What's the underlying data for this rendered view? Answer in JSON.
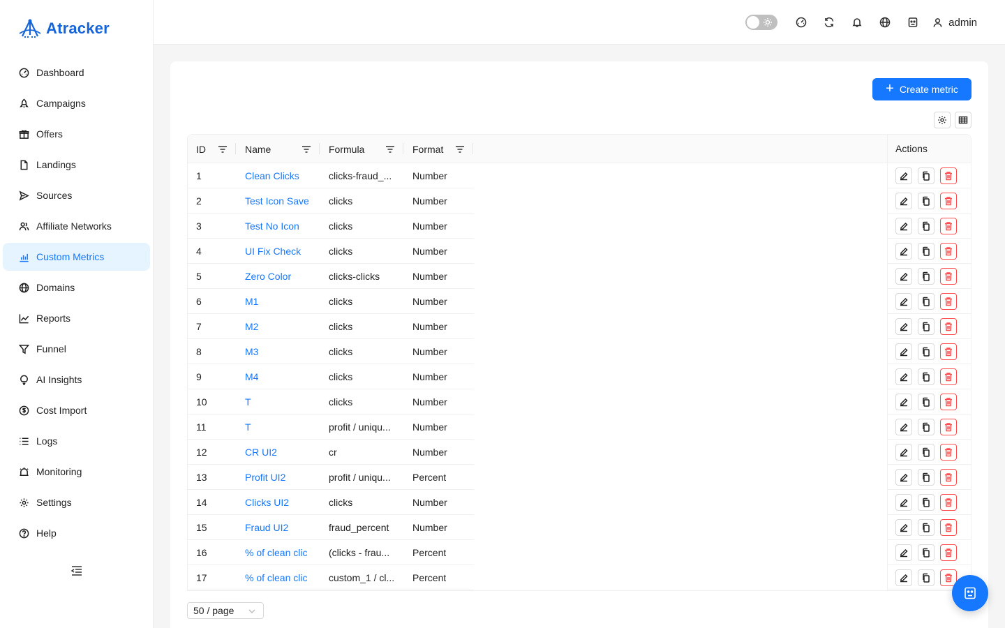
{
  "app": {
    "name": "Atracker"
  },
  "sidebar": {
    "items": [
      {
        "label": "Dashboard",
        "icon": "dashboard-icon"
      },
      {
        "label": "Campaigns",
        "icon": "rocket-icon"
      },
      {
        "label": "Offers",
        "icon": "gift-icon"
      },
      {
        "label": "Landings",
        "icon": "file-icon"
      },
      {
        "label": "Sources",
        "icon": "send-icon"
      },
      {
        "label": "Affiliate Networks",
        "icon": "users-icon"
      },
      {
        "label": "Custom Metrics",
        "icon": "bar-chart-icon",
        "active": true
      },
      {
        "label": "Domains",
        "icon": "globe-icon"
      },
      {
        "label": "Reports",
        "icon": "line-chart-icon"
      },
      {
        "label": "Funnel",
        "icon": "funnel-icon"
      },
      {
        "label": "AI Insights",
        "icon": "bulb-icon"
      },
      {
        "label": "Cost Import",
        "icon": "dollar-icon"
      },
      {
        "label": "Logs",
        "icon": "list-icon"
      },
      {
        "label": "Monitoring",
        "icon": "alert-icon"
      },
      {
        "label": "Settings",
        "icon": "gear-icon"
      },
      {
        "label": "Help",
        "icon": "question-icon"
      }
    ]
  },
  "header": {
    "user": "admin"
  },
  "toolbar": {
    "create_label": "Create metric"
  },
  "table": {
    "columns": {
      "id": "ID",
      "name": "Name",
      "formula": "Formula",
      "format": "Format",
      "actions": "Actions"
    },
    "rows": [
      {
        "id": "1",
        "name": "Clean Clicks",
        "formula": "clicks-fraud_...",
        "format": "Number"
      },
      {
        "id": "2",
        "name": "Test Icon Save",
        "formula": "clicks",
        "format": "Number"
      },
      {
        "id": "3",
        "name": "Test No Icon",
        "formula": "clicks",
        "format": "Number"
      },
      {
        "id": "4",
        "name": "UI Fix Check",
        "formula": "clicks",
        "format": "Number"
      },
      {
        "id": "5",
        "name": "Zero Color",
        "formula": "clicks-clicks",
        "format": "Number"
      },
      {
        "id": "6",
        "name": "M1",
        "formula": "clicks",
        "format": "Number"
      },
      {
        "id": "7",
        "name": "M2",
        "formula": "clicks",
        "format": "Number"
      },
      {
        "id": "8",
        "name": "M3",
        "formula": "clicks",
        "format": "Number"
      },
      {
        "id": "9",
        "name": "M4",
        "formula": "clicks",
        "format": "Number"
      },
      {
        "id": "10",
        "name": "T",
        "formula": "clicks",
        "format": "Number"
      },
      {
        "id": "11",
        "name": "T",
        "formula": "profit / uniqu...",
        "format": "Number"
      },
      {
        "id": "12",
        "name": "CR UI2",
        "formula": "cr",
        "format": "Number"
      },
      {
        "id": "13",
        "name": "Profit UI2",
        "formula": "profit / uniqu...",
        "format": "Percent"
      },
      {
        "id": "14",
        "name": "Clicks UI2",
        "formula": "clicks",
        "format": "Number"
      },
      {
        "id": "15",
        "name": "Fraud UI2",
        "formula": "fraud_percent",
        "format": "Number"
      },
      {
        "id": "16",
        "name": "% of clean clic",
        "formula": "(clicks - frau...",
        "format": "Percent"
      },
      {
        "id": "17",
        "name": "% of clean clic",
        "formula": "custom_1 / cl...",
        "format": "Percent"
      }
    ]
  },
  "pagination": {
    "page_size": "50 / page"
  },
  "colors": {
    "primary": "#1677ff",
    "danger": "#ff4d4f",
    "active_bg": "#e6f4ff"
  }
}
